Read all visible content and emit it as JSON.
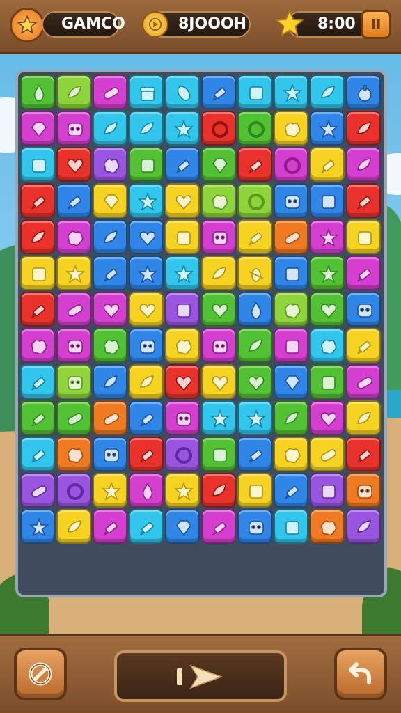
{
  "header": {
    "title": "GAMCO",
    "score": "8JOOOH",
    "timer": "8:00",
    "pause_label": "II"
  },
  "colors": {
    "frame_wood": "#8a5a33",
    "tile_green": "#52c234",
    "tile_lime": "#8ed43a",
    "tile_cyan": "#31c6ec",
    "tile_blue": "#2f86e6",
    "tile_magenta": "#d43fcf",
    "tile_purple": "#9a55e0",
    "tile_red": "#e8322b",
    "tile_orange": "#f07a22",
    "tile_yellow": "#f6d321"
  },
  "board": {
    "cols": 10,
    "rows": 13,
    "tiles": [
      [
        "green:drop",
        "lime:leaf",
        "magenta:pill",
        "cyan:gift",
        "cyan:bean",
        "blue:pencil",
        "cyan:box",
        "cyan:star",
        "cyan:leaf",
        "blue:apple"
      ],
      [
        "magenta:gem",
        "magenta:face",
        "cyan:leaf",
        "cyan:leaf",
        "cyan:star",
        "red:ring",
        "green:ring",
        "yellow:blob",
        "blue:star",
        "red:leaf"
      ],
      [
        "cyan:box",
        "red:heart",
        "purple:blob",
        "green:box",
        "blue:pencil",
        "green:gem",
        "red:pencil",
        "magenta:ring",
        "yellow:pencil",
        "magenta:leaf"
      ],
      [
        "red:pencil",
        "blue:pencil",
        "yellow:gem",
        "cyan:star",
        "yellow:heart",
        "lime:blob",
        "lime:ring",
        "blue:face",
        "blue:box",
        "red:pencil"
      ],
      [
        "red:leaf",
        "magenta:blob",
        "blue:leaf",
        "blue:heart",
        "yellow:box",
        "magenta:face",
        "yellow:pencil",
        "orange:pill",
        "magenta:star",
        "yellow:box"
      ],
      [
        "yellow:box",
        "yellow:star",
        "blue:pencil",
        "blue:star",
        "cyan:star",
        "yellow:leaf",
        "yellow:bug",
        "blue:box",
        "green:star",
        "magenta:pencil"
      ],
      [
        "red:pencil",
        "magenta:pill",
        "magenta:heart",
        "yellow:heart",
        "purple:box",
        "green:heart",
        "blue:drop",
        "lime:blob",
        "green:heart",
        "blue:face"
      ],
      [
        "magenta:blob",
        "magenta:face",
        "green:blob",
        "blue:face",
        "yellow:blob",
        "magenta:face",
        "green:leaf",
        "magenta:box",
        "cyan:blob",
        "yellow:pencil"
      ],
      [
        "cyan:pencil",
        "lime:face",
        "blue:leaf",
        "yellow:leaf",
        "red:heart",
        "yellow:heart",
        "green:heart",
        "blue:gem",
        "green:box",
        "magenta:pill"
      ],
      [
        "green:pencil",
        "green:pill",
        "orange:pill",
        "blue:pencil",
        "magenta:face",
        "cyan:star",
        "cyan:star",
        "green:leaf",
        "magenta:heart",
        "yellow:leaf"
      ],
      [
        "cyan:pencil",
        "orange:blob",
        "blue:face",
        "red:pencil",
        "purple:ring",
        "green:box",
        "blue:pencil",
        "yellow:blob",
        "yellow:pill",
        "red:pencil"
      ],
      [
        "purple:pill",
        "purple:ring",
        "yellow:star",
        "magenta:drop",
        "yellow:star",
        "red:leaf",
        "yellow:box",
        "blue:pencil",
        "purple:box",
        "orange:face"
      ],
      [
        "blue:star",
        "yellow:leaf",
        "magenta:pencil",
        "cyan:pencil",
        "blue:gem",
        "magenta:pencil",
        "blue:face",
        "cyan:box",
        "orange:blob",
        "purple:leaf"
      ]
    ]
  },
  "bottom": {
    "left_icon": "no-entry-icon",
    "center_icon": "play-icon",
    "right_icon": "undo-arrow-icon"
  }
}
